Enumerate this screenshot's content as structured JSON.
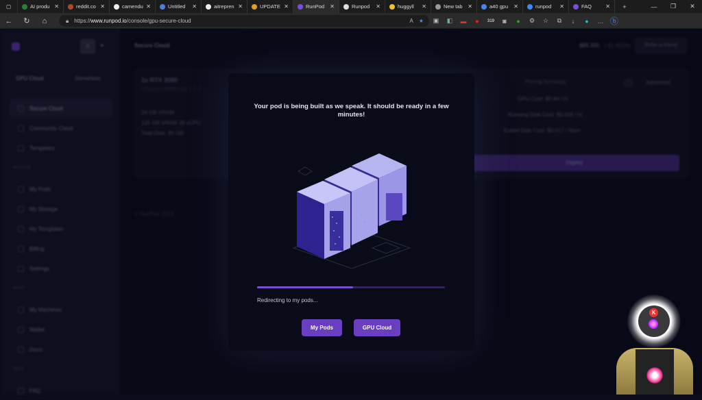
{
  "browser": {
    "tabs": [
      {
        "label": "AI produ",
        "color": "#2f7d3a"
      },
      {
        "label": "reddit.co",
        "color": "#b0472c"
      },
      {
        "label": "camendu",
        "color": "#eeeeee"
      },
      {
        "label": "Untitled",
        "color": "#4a7de0"
      },
      {
        "label": "aitrepren",
        "color": "#eeeeee"
      },
      {
        "label": "UPDATE",
        "color": "#e0a020"
      },
      {
        "label": "RunPod",
        "color": "#7a4fd8",
        "active": true
      },
      {
        "label": "Runpod",
        "color": "#dddddd"
      },
      {
        "label": "huggyll",
        "color": "#f0c030"
      },
      {
        "label": "New tab",
        "color": "#999999"
      },
      {
        "label": "a40 gpu",
        "color": "#4285f4"
      },
      {
        "label": "runpod",
        "color": "#4285f4"
      },
      {
        "label": "FAQ",
        "color": "#7a4fd8"
      }
    ],
    "url_prefix": "https://",
    "url_host": "www.runpod.io",
    "url_path": "/console/gpu-secure-cloud",
    "extension_badge": "319"
  },
  "sidebar": {
    "avatar_letter": "A",
    "tabs": [
      "GPU Cloud",
      "Serverless"
    ],
    "items": [
      "Secure Cloud",
      "Community Cloud",
      "Templates"
    ],
    "manage_label": "MANAGE",
    "manage": [
      "My Pods",
      "My Storage",
      "My Templates",
      "Billing",
      "Settings"
    ],
    "host_label": "HOST",
    "host": [
      "My Machines",
      "Wallet",
      "Docs"
    ],
    "help_label": "HELP",
    "help": [
      "FAQ"
    ]
  },
  "main": {
    "title": "Secure Cloud",
    "balance": "$65.300",
    "rate": "| $1.455/hr",
    "refer": "Refer a friend",
    "gpu": "1x RTX 3090",
    "image": "runpod/oobabooga:1.0.1",
    "specs": [
      "24 GB VRAM",
      "125 GB VRAM 28 vCPU",
      "Total Disk: 85 GB"
    ],
    "advanced": "Advanced",
    "pricing_title": "Pricing Summary",
    "pricing": [
      "GPU Cost: $0.44 / hr",
      "Running Disk Cost: $0.006 / hr",
      "Exited Disk Cost: $0.017 / Hour"
    ],
    "deploy": "Deploy",
    "footer": "© RunPod 2023"
  },
  "modal": {
    "message": "Your pod is being built as we speak. It should be ready in a few minutes!",
    "progress_percent": 51,
    "status": "Redirecting to my pods...",
    "buttons": [
      "My Pods",
      "GPU Cloud"
    ]
  },
  "overlay_avatar_letter": "K"
}
